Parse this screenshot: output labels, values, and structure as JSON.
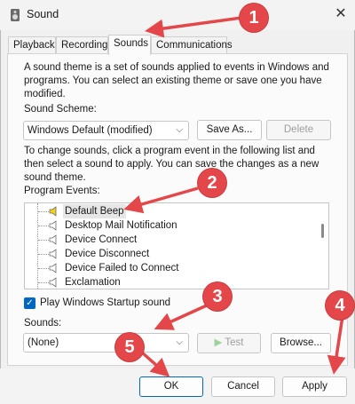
{
  "window": {
    "title": "Sound",
    "close_glyph": "✕"
  },
  "tabs": [
    {
      "label": "Playback"
    },
    {
      "label": "Recording"
    },
    {
      "label": "Sounds",
      "active": true
    },
    {
      "label": "Communications"
    }
  ],
  "description": "A sound theme is a set of sounds applied to events in Windows and programs. You can select an existing theme or save one you have modified.",
  "scheme": {
    "label": "Sound Scheme:",
    "value": "Windows Default (modified)",
    "save_as": "Save As...",
    "delete": "Delete"
  },
  "instructions": "To change sounds, click a program event in the following list and then select a sound to apply. You can save the changes as a new sound theme.",
  "events": {
    "label": "Program Events:",
    "items": [
      {
        "label": "Default Beep",
        "selected": true
      },
      {
        "label": "Desktop Mail Notification"
      },
      {
        "label": "Device Connect"
      },
      {
        "label": "Device Disconnect"
      },
      {
        "label": "Device Failed to Connect"
      },
      {
        "label": "Exclamation"
      }
    ]
  },
  "startup": {
    "label": "Play Windows Startup sound",
    "checked": true
  },
  "sounds": {
    "label": "Sounds:",
    "value": "(None)",
    "test": "Test",
    "browse": "Browse..."
  },
  "footer": {
    "ok": "OK",
    "cancel": "Cancel",
    "apply": "Apply"
  },
  "annotations": [
    {
      "number": "1"
    },
    {
      "number": "2"
    },
    {
      "number": "3"
    },
    {
      "number": "4"
    },
    {
      "number": "5"
    }
  ],
  "colors": {
    "accent": "#0067c0",
    "annotation": "#e4474a",
    "speaker_selected": "#f2d21b"
  }
}
